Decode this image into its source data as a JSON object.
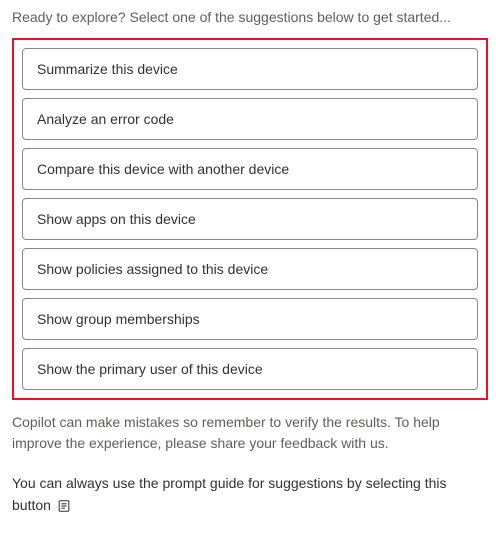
{
  "intro": "Ready to explore? Select one of the suggestions below to get started...",
  "suggestions": [
    {
      "label": "Summarize this device"
    },
    {
      "label": "Analyze an error code"
    },
    {
      "label": "Compare this device with another device"
    },
    {
      "label": "Show apps on this device"
    },
    {
      "label": "Show policies assigned to this device"
    },
    {
      "label": "Show group memberships"
    },
    {
      "label": "Show the primary user of this device"
    }
  ],
  "disclaimer": "Copilot can make mistakes so remember to verify the results. To help improve the experience, please share your feedback with us.",
  "promptGuideText": "You can always use the prompt guide for suggestions by selecting this button",
  "icons": {
    "promptGuide": "prompt-guide-icon"
  }
}
